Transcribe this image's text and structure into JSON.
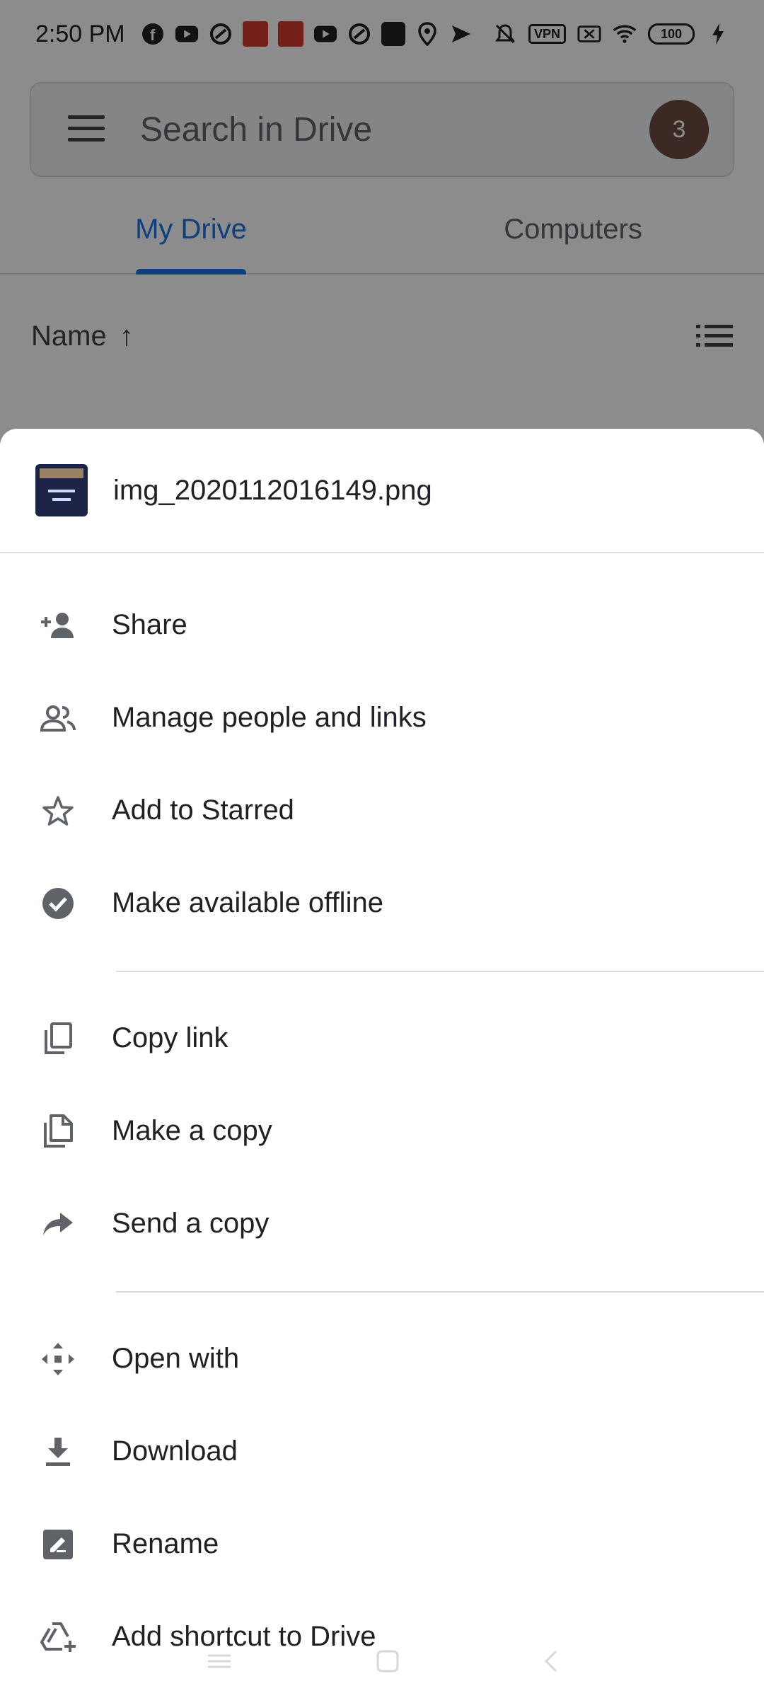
{
  "status_bar": {
    "time": "2:50 PM",
    "vpn_label": "VPN",
    "battery": "100"
  },
  "search": {
    "placeholder": "Search in Drive",
    "avatar_initial": "3"
  },
  "tabs": [
    {
      "label": "My Drive",
      "active": true
    },
    {
      "label": "Computers",
      "active": false
    }
  ],
  "sort": {
    "label": "Name",
    "direction_icon": "arrow-up-icon"
  },
  "sheet": {
    "file_name": "img_2020112016149.png",
    "sections": [
      [
        {
          "label": "Share",
          "icon": "person-add-icon"
        },
        {
          "label": "Manage people and links",
          "icon": "people-icon"
        },
        {
          "label": "Add to Starred",
          "icon": "star-icon"
        },
        {
          "label": "Make available offline",
          "icon": "offline-check-icon"
        }
      ],
      [
        {
          "label": "Copy link",
          "icon": "copy-link-icon"
        },
        {
          "label": "Make a copy",
          "icon": "file-copy-icon"
        },
        {
          "label": "Send a copy",
          "icon": "forward-icon"
        }
      ],
      [
        {
          "label": "Open with",
          "icon": "open-with-icon"
        },
        {
          "label": "Download",
          "icon": "download-icon"
        },
        {
          "label": "Rename",
          "icon": "rename-icon"
        },
        {
          "label": "Add shortcut to Drive",
          "icon": "add-shortcut-icon"
        }
      ]
    ]
  },
  "colors": {
    "accent": "#1a73e8",
    "icon": "#5f6368",
    "text": "#202124"
  }
}
